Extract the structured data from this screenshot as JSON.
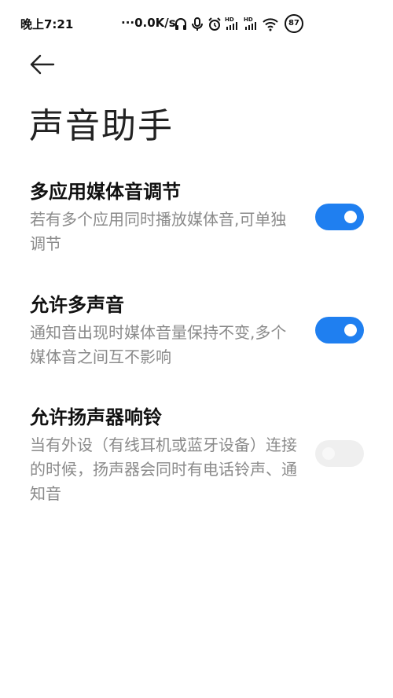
{
  "status_bar": {
    "time": "晚上7:21",
    "network_speed": "···0.0K/s",
    "battery": "87",
    "icons": [
      "headphones-icon",
      "microphone-icon",
      "alarm-icon",
      "hd-signal-icon",
      "hd-signal-icon",
      "wifi-icon",
      "battery-icon"
    ]
  },
  "header": {
    "title": "声音助手",
    "back_icon": "arrow-left-icon"
  },
  "settings": [
    {
      "title": "多应用媒体音调节",
      "description": "若有多个应用同时播放媒体音,可单独调节",
      "enabled": true
    },
    {
      "title": "允许多声音",
      "description": "通知音出现时媒体音量保持不变,多个媒体音之间互不影响",
      "enabled": true
    },
    {
      "title": "允许扬声器响铃",
      "description": "当有外设（有线耳机或蓝牙设备）连接的时候，扬声器会同时有电话铃声、通知音",
      "enabled": false
    }
  ],
  "colors": {
    "accent": "#1f7ff0",
    "toggle_off": "#efefef",
    "description_text": "#8a8a8a"
  }
}
